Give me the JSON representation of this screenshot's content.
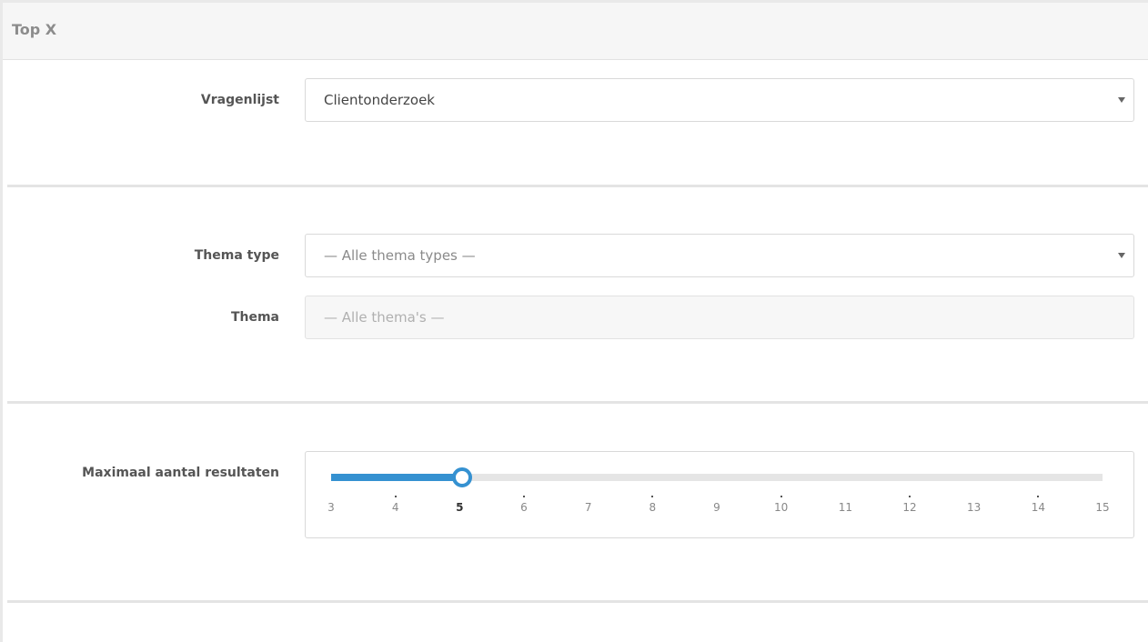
{
  "panel": {
    "title": "Top X"
  },
  "vragenlijst": {
    "label": "Vragenlijst",
    "value": "Clientonderzoek",
    "icon": "chevron-down-icon"
  },
  "thema_type": {
    "label": "Thema type",
    "placeholder": "— Alle thema types —",
    "icon": "chevron-down-icon"
  },
  "thema": {
    "label": "Thema",
    "placeholder": "— Alle thema's —",
    "disabled": true
  },
  "max_results": {
    "label": "Maximaal aantal resultaten",
    "min": 3,
    "max": 15,
    "value": 5,
    "ticks": [
      "3",
      "4",
      "5",
      "6",
      "7",
      "8",
      "9",
      "10",
      "11",
      "12",
      "13",
      "14",
      "15"
    ],
    "accent_color": "#3591d1"
  }
}
